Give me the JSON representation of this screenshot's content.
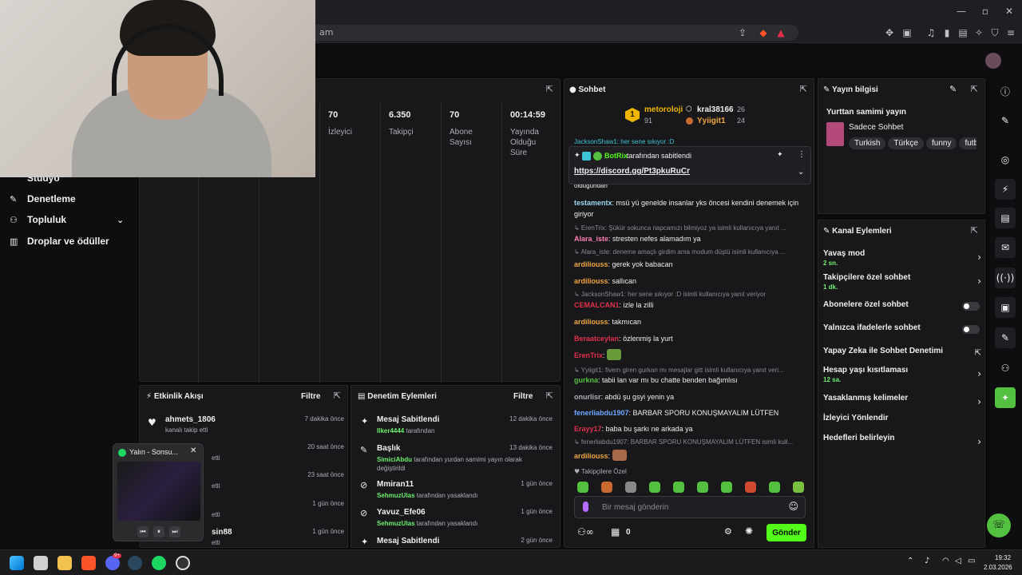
{
  "browser": {
    "url_fragment": "am"
  },
  "sidebar": {
    "items": [
      {
        "label": "Stüdyo"
      },
      {
        "label": "Denetleme"
      },
      {
        "label": "Topluluk"
      },
      {
        "label": "Droplar ve ödüller"
      }
    ]
  },
  "stats": [
    {
      "value": "70",
      "label": "İzleyici"
    },
    {
      "value": "6.350",
      "label": "Takipçi"
    },
    {
      "value": "70",
      "label": "Abone Sayısı"
    },
    {
      "value": "00:14:59",
      "label": "Yayında Olduğu Süre"
    }
  ],
  "activity": {
    "title": "Etkinlik Akışı",
    "filter": "Filtre",
    "items": [
      {
        "name": "ahmets_1806",
        "sub": "kanalı takip etti",
        "time": "7 dakika önce"
      },
      {
        "name": "",
        "sub": "etti",
        "time": "20 saat önce"
      },
      {
        "name": "",
        "sub": "etti",
        "time": "23 saat önce"
      },
      {
        "name": "",
        "sub": "etti",
        "time": "1 gün önce"
      },
      {
        "name": "sin88",
        "sub": "etti",
        "time": "1 gün önce"
      }
    ]
  },
  "spotify_popup": {
    "title": "Yalın - Sonsu..."
  },
  "moderation": {
    "title": "Denetim Eylemleri",
    "filter": "Filtre",
    "items": [
      {
        "title": "Mesaj Sabitlendi",
        "user": "Ilker4444",
        "rest": " tarafından",
        "time": "12 dakika önce"
      },
      {
        "title": "Başlık",
        "user": "SimiciAbdu",
        "rest": " tarafından yurdan samimi yayın olarak değiştirildi",
        "time": "13 dakika önce"
      },
      {
        "title": "Mmiran11",
        "user": "SehmuzUlas",
        "rest": " tarafından yasaklandı",
        "time": "1 gün önce"
      },
      {
        "title": "Yavuz_Efe06",
        "user": "SehmuzUlas",
        "rest": " tarafından yasaklandı",
        "time": "1 gün önce"
      },
      {
        "title": "Mesaj Sabitlendi",
        "user": "",
        "rest": "",
        "time": "2 gün önce"
      }
    ]
  },
  "chat": {
    "title": "Sohbet",
    "leaderboard": [
      {
        "rank": "1",
        "name": "metoroloji",
        "score": "91"
      },
      {
        "rank": "",
        "name": "kral38166",
        "score": "26"
      },
      {
        "rank": "",
        "name": "Yyiigit1",
        "score": "24"
      }
    ],
    "top_cut": "JacksonShaw1: her sene sıkıyor :D",
    "pinned": {
      "by": "BotRix",
      "by_suffix": "tarafından sabitlendi",
      "link": "https://discord.gg/Pt3pkuRuCr"
    },
    "messages": [
      {
        "kind": "cut",
        "text": "olduğundan"
      },
      {
        "kind": "msg",
        "user": "testamentx",
        "color": "#9ad7f0",
        "text": "msü yü genelde insanlar yks öncesi kendini denemek için giriyor"
      },
      {
        "kind": "reply",
        "text": "↳ ErenTrix: Şükür sokunca napcamızı bilmiyoz ya isimli kullanıcıya yanıt ..."
      },
      {
        "kind": "msg",
        "user": "Alara_iste",
        "color": "#ff7eb0",
        "text": "stresten nefes alamadım ya"
      },
      {
        "kind": "reply",
        "text": "↳ Alara_iste: deneme amaçlı girdim ama modum düştü isimli kullanıcıya ..."
      },
      {
        "kind": "msg",
        "user": "ardiliouss",
        "color": "#f0a640",
        "text": "gerek yok babacan"
      },
      {
        "kind": "msg",
        "user": "ardiliouss",
        "color": "#f0a640",
        "text": "sallıcan"
      },
      {
        "kind": "reply",
        "text": "↳ JacksonShaw1: her sene sıkıyor :D isimli kullanıcıya yanıt veriyor"
      },
      {
        "kind": "msg",
        "user": "CEMALCAN1",
        "color": "#e0304a",
        "text": "izle la zilli"
      },
      {
        "kind": "msg",
        "user": "ardiliouss",
        "color": "#f0a640",
        "text": "takmıcan"
      },
      {
        "kind": "msg",
        "user": "Beraatceylan",
        "color": "#e0304a",
        "text": "özlenmiş la yurt"
      },
      {
        "kind": "msg",
        "user": "ErenTrix",
        "color": "#e0304a",
        "text": ""
      },
      {
        "kind": "reply",
        "text": "↳ Yyiigit1: fivem giren gurkan mı mesajlar gitt isimli kullanıcıya yanıt veri..."
      },
      {
        "kind": "msg",
        "user": "gurkna",
        "color": "#53c040",
        "text": "tabii lan var mı bu chatte benden bağımlısı"
      },
      {
        "kind": "msg",
        "user": "onurlisr",
        "color": "#adadb8",
        "text": "abdü şu gsyi yenin ya"
      },
      {
        "kind": "msg",
        "user": "fenerliabdu1907",
        "color": "#6ea8ff",
        "text": "BARBAR SPORU KONUŞMAYALIM LÜTFEN"
      },
      {
        "kind": "msg",
        "user": "Erayy17",
        "color": "#e0304a",
        "text": "baba bu şarkı ne arkada ya"
      },
      {
        "kind": "reply",
        "text": "↳ fenerliabdu1907: BARBAR SPORU KONUŞMAYALIM LÜTFEN isimli kull..."
      },
      {
        "kind": "msg",
        "user": "ardiliouss",
        "color": "#f0a640",
        "text": ""
      }
    ],
    "followers_only": "Takipçilere Özel",
    "input_placeholder": "Bir mesaj gönderin",
    "points": "0",
    "send_label": "Gönder"
  },
  "stream_info": {
    "title": "Yayın bilgisi",
    "stream_title": "Yurttan samimi yayın",
    "category": "Sadece Sohbet",
    "tags": [
      "Turkish",
      "Türkçe",
      "funny",
      "futb"
    ]
  },
  "channel_actions": {
    "title": "Kanal Eylemleri",
    "items": [
      {
        "label": "Yavaş mod",
        "sub": "2 sn.",
        "control": "chevron"
      },
      {
        "label": "Takipçilere özel sohbet",
        "sub": "1 dk.",
        "control": "chevron"
      },
      {
        "label": "Abonelere özel sohbet",
        "sub": "",
        "control": "toggle"
      },
      {
        "label": "Yalnızca ifadelerle sohbet",
        "sub": "",
        "control": "toggle"
      },
      {
        "label": "Yapay Zeka ile Sohbet Denetimi",
        "sub": "",
        "control": "external"
      },
      {
        "label": "Hesap yaşı kısıtlaması",
        "sub": "12 sa.",
        "control": "chevron"
      },
      {
        "label": "Yasaklanmış kelimeler",
        "sub": "",
        "control": "chevron"
      },
      {
        "label": "İzleyici Yönlendir",
        "sub": "",
        "control": "none"
      },
      {
        "label": "Hedefleri belirleyin",
        "sub": "",
        "control": "chevron"
      }
    ]
  },
  "taskbar": {
    "time": "19:32",
    "date": "2.03.2026",
    "discord_badge": "9+"
  },
  "colors": {
    "accent_green": "#53fc18",
    "panel_bg": "#18181b",
    "page_bg": "#0b0b0c"
  }
}
